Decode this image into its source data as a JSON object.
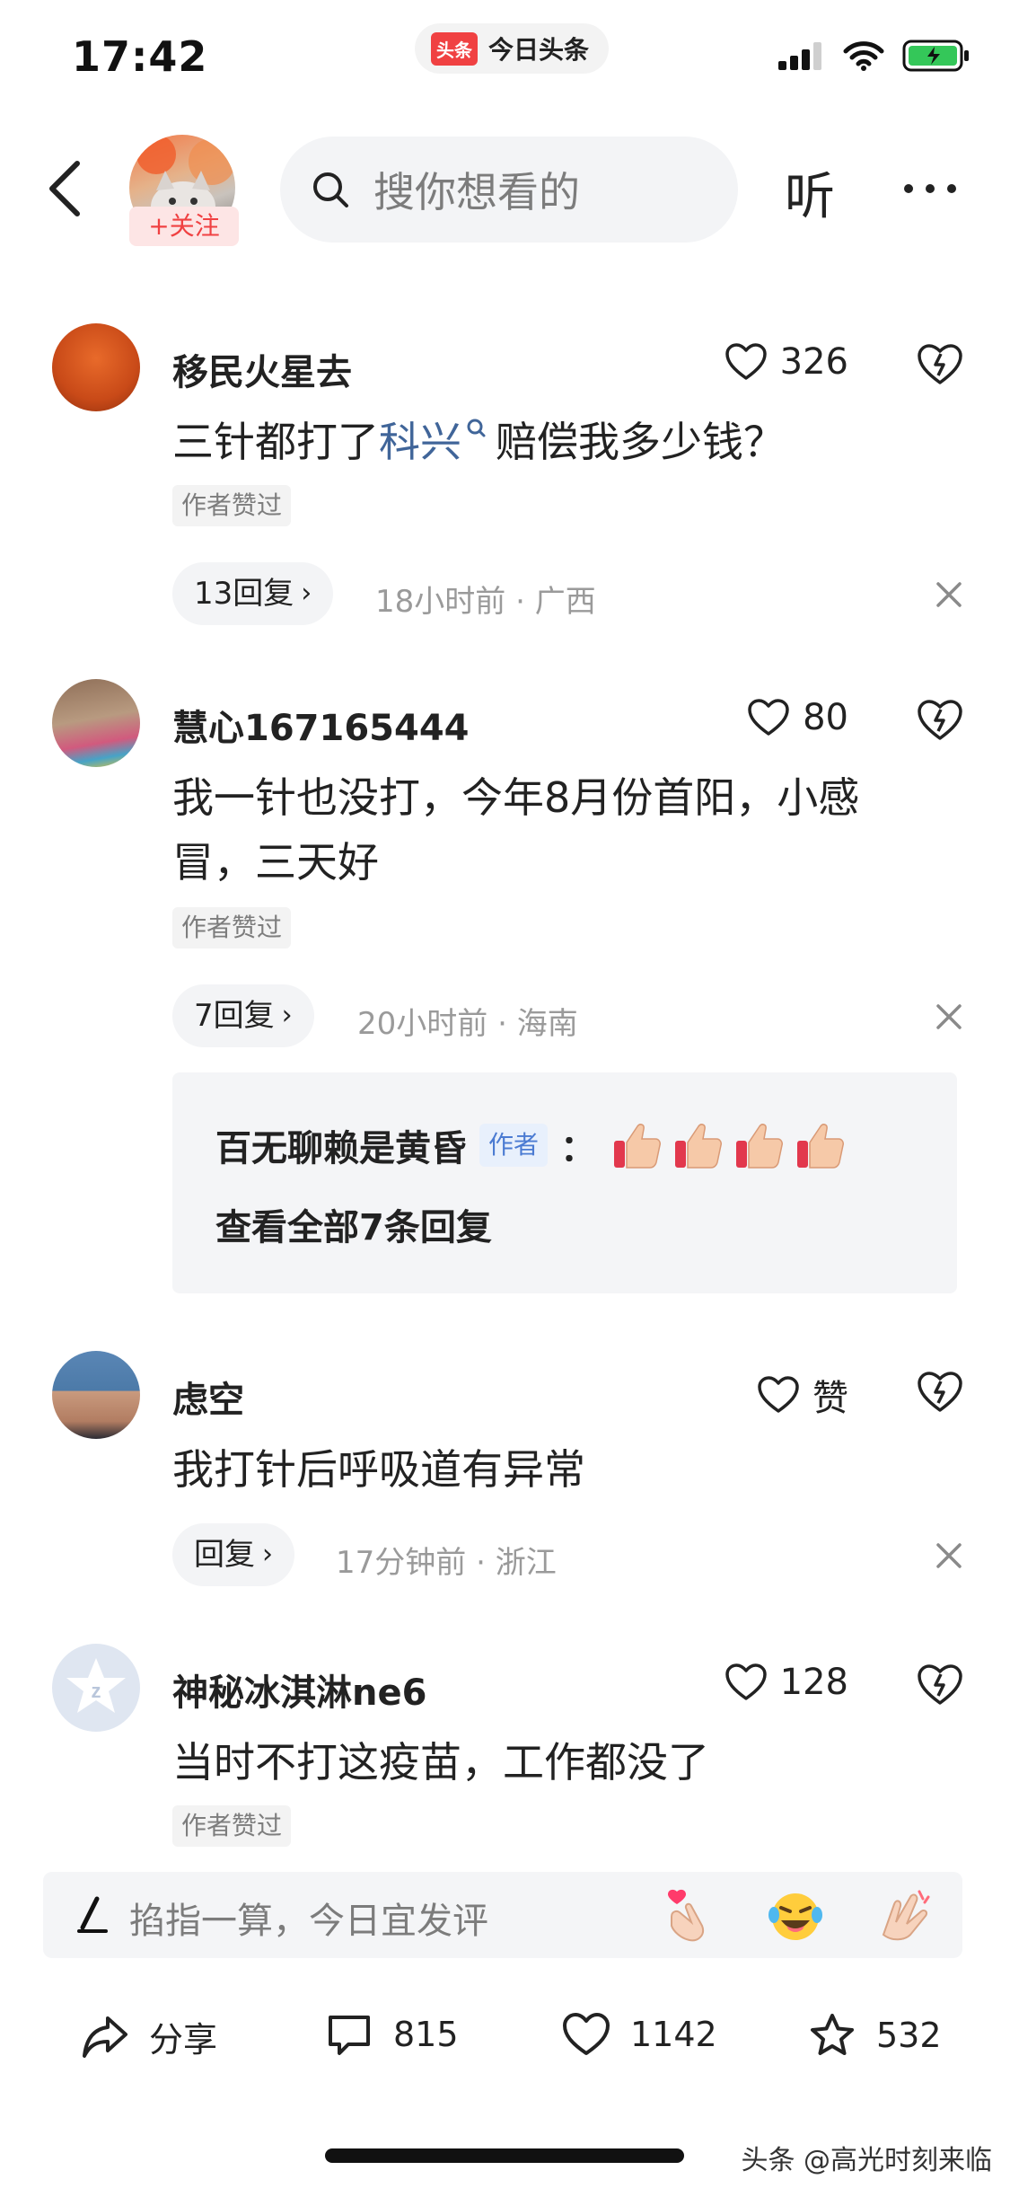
{
  "status_bar": {
    "time": "17:42",
    "app_logo": "头条",
    "app_name": "今日头条"
  },
  "header": {
    "follow_label": "+关注",
    "search_placeholder": "搜你想看的",
    "listen_label": "听"
  },
  "comments": [
    {
      "name": "移民火星去",
      "likes": "326",
      "text_before": "三针都打了",
      "link": "科兴",
      "text_after": "赔偿我多少钱？",
      "badge": "作者赞过",
      "reply_label": "13回复",
      "time": "18小时前",
      "location": "广西"
    },
    {
      "name": "慧心167165444",
      "likes": "80",
      "text_line1": "我一针也没打，今年8月份首阳，小感",
      "text_line2": "冒，三天好",
      "badge": "作者赞过",
      "reply_label": "7回复",
      "time": "20小时前",
      "location": "海南",
      "reply": {
        "author": "百无聊赖是黄昏",
        "author_tag": "作者",
        "colon": "：",
        "view_all": "查看全部7条回复"
      }
    },
    {
      "name": "虑空",
      "likes": "赞",
      "text": "我打针后呼吸道有异常",
      "reply_label": "回复",
      "time": "17分钟前",
      "location": "浙江"
    },
    {
      "name": "神秘冰淇淋ne6",
      "likes": "128",
      "text": "当时不打这疫苗，工作都没了",
      "badge": "作者赞过"
    }
  ],
  "meta_separator": " · ",
  "input_bar": {
    "placeholder": "掐指一算，今日宜发评"
  },
  "bottom_bar": {
    "share_label": "分享",
    "comments_count": "815",
    "likes_count": "1142",
    "favorites_count": "532"
  },
  "watermark": "头条 @高光时刻来临",
  "colors": {
    "brand_red": "#f04142",
    "link_blue": "#406599",
    "author_tag_blue": "#4b7bd2",
    "battery_green": "#34c759"
  },
  "icons": [
    "back-arrow-icon",
    "search-icon",
    "more-icon",
    "heart-icon",
    "broken-heart-icon",
    "close-icon",
    "pen-icon",
    "share-icon",
    "comment-icon",
    "star-icon",
    "thumbs-up-icon",
    "finger-heart-icon",
    "laughing-icon",
    "clap-icon",
    "signal-icon",
    "wifi-icon",
    "battery-icon"
  ]
}
